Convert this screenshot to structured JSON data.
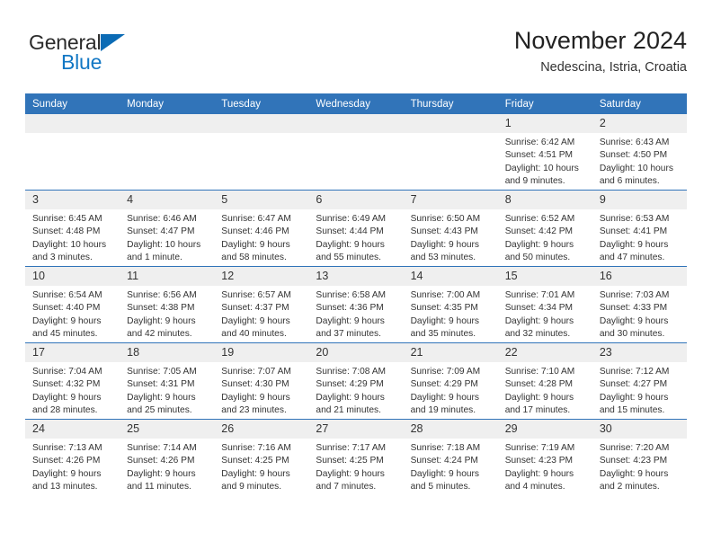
{
  "brand": {
    "name_part1": "General",
    "name_part2": "Blue",
    "triangle_color": "#0b6bb5",
    "text_color": "#2b2b2b",
    "blue_color": "#1277c4"
  },
  "header": {
    "title": "November 2024",
    "subtitle": "Nedescina, Istria, Croatia"
  },
  "theme": {
    "header_bar": "#3174b9",
    "daynum_bg": "#efefef",
    "cell_bg": "#ffffff",
    "text": "#333333"
  },
  "weekday_headers": [
    "Sunday",
    "Monday",
    "Tuesday",
    "Wednesday",
    "Thursday",
    "Friday",
    "Saturday"
  ],
  "weeks": [
    [
      {
        "day": "",
        "empty": true,
        "sunrise": "",
        "sunset": "",
        "daylight1": "",
        "daylight2": ""
      },
      {
        "day": "",
        "empty": true,
        "sunrise": "",
        "sunset": "",
        "daylight1": "",
        "daylight2": ""
      },
      {
        "day": "",
        "empty": true,
        "sunrise": "",
        "sunset": "",
        "daylight1": "",
        "daylight2": ""
      },
      {
        "day": "",
        "empty": true,
        "sunrise": "",
        "sunset": "",
        "daylight1": "",
        "daylight2": ""
      },
      {
        "day": "",
        "empty": true,
        "sunrise": "",
        "sunset": "",
        "daylight1": "",
        "daylight2": ""
      },
      {
        "day": "1",
        "empty": false,
        "sunrise": "Sunrise: 6:42 AM",
        "sunset": "Sunset: 4:51 PM",
        "daylight1": "Daylight: 10 hours",
        "daylight2": "and 9 minutes."
      },
      {
        "day": "2",
        "empty": false,
        "sunrise": "Sunrise: 6:43 AM",
        "sunset": "Sunset: 4:50 PM",
        "daylight1": "Daylight: 10 hours",
        "daylight2": "and 6 minutes."
      }
    ],
    [
      {
        "day": "3",
        "empty": false,
        "sunrise": "Sunrise: 6:45 AM",
        "sunset": "Sunset: 4:48 PM",
        "daylight1": "Daylight: 10 hours",
        "daylight2": "and 3 minutes."
      },
      {
        "day": "4",
        "empty": false,
        "sunrise": "Sunrise: 6:46 AM",
        "sunset": "Sunset: 4:47 PM",
        "daylight1": "Daylight: 10 hours",
        "daylight2": "and 1 minute."
      },
      {
        "day": "5",
        "empty": false,
        "sunrise": "Sunrise: 6:47 AM",
        "sunset": "Sunset: 4:46 PM",
        "daylight1": "Daylight: 9 hours",
        "daylight2": "and 58 minutes."
      },
      {
        "day": "6",
        "empty": false,
        "sunrise": "Sunrise: 6:49 AM",
        "sunset": "Sunset: 4:44 PM",
        "daylight1": "Daylight: 9 hours",
        "daylight2": "and 55 minutes."
      },
      {
        "day": "7",
        "empty": false,
        "sunrise": "Sunrise: 6:50 AM",
        "sunset": "Sunset: 4:43 PM",
        "daylight1": "Daylight: 9 hours",
        "daylight2": "and 53 minutes."
      },
      {
        "day": "8",
        "empty": false,
        "sunrise": "Sunrise: 6:52 AM",
        "sunset": "Sunset: 4:42 PM",
        "daylight1": "Daylight: 9 hours",
        "daylight2": "and 50 minutes."
      },
      {
        "day": "9",
        "empty": false,
        "sunrise": "Sunrise: 6:53 AM",
        "sunset": "Sunset: 4:41 PM",
        "daylight1": "Daylight: 9 hours",
        "daylight2": "and 47 minutes."
      }
    ],
    [
      {
        "day": "10",
        "empty": false,
        "sunrise": "Sunrise: 6:54 AM",
        "sunset": "Sunset: 4:40 PM",
        "daylight1": "Daylight: 9 hours",
        "daylight2": "and 45 minutes."
      },
      {
        "day": "11",
        "empty": false,
        "sunrise": "Sunrise: 6:56 AM",
        "sunset": "Sunset: 4:38 PM",
        "daylight1": "Daylight: 9 hours",
        "daylight2": "and 42 minutes."
      },
      {
        "day": "12",
        "empty": false,
        "sunrise": "Sunrise: 6:57 AM",
        "sunset": "Sunset: 4:37 PM",
        "daylight1": "Daylight: 9 hours",
        "daylight2": "and 40 minutes."
      },
      {
        "day": "13",
        "empty": false,
        "sunrise": "Sunrise: 6:58 AM",
        "sunset": "Sunset: 4:36 PM",
        "daylight1": "Daylight: 9 hours",
        "daylight2": "and 37 minutes."
      },
      {
        "day": "14",
        "empty": false,
        "sunrise": "Sunrise: 7:00 AM",
        "sunset": "Sunset: 4:35 PM",
        "daylight1": "Daylight: 9 hours",
        "daylight2": "and 35 minutes."
      },
      {
        "day": "15",
        "empty": false,
        "sunrise": "Sunrise: 7:01 AM",
        "sunset": "Sunset: 4:34 PM",
        "daylight1": "Daylight: 9 hours",
        "daylight2": "and 32 minutes."
      },
      {
        "day": "16",
        "empty": false,
        "sunrise": "Sunrise: 7:03 AM",
        "sunset": "Sunset: 4:33 PM",
        "daylight1": "Daylight: 9 hours",
        "daylight2": "and 30 minutes."
      }
    ],
    [
      {
        "day": "17",
        "empty": false,
        "sunrise": "Sunrise: 7:04 AM",
        "sunset": "Sunset: 4:32 PM",
        "daylight1": "Daylight: 9 hours",
        "daylight2": "and 28 minutes."
      },
      {
        "day": "18",
        "empty": false,
        "sunrise": "Sunrise: 7:05 AM",
        "sunset": "Sunset: 4:31 PM",
        "daylight1": "Daylight: 9 hours",
        "daylight2": "and 25 minutes."
      },
      {
        "day": "19",
        "empty": false,
        "sunrise": "Sunrise: 7:07 AM",
        "sunset": "Sunset: 4:30 PM",
        "daylight1": "Daylight: 9 hours",
        "daylight2": "and 23 minutes."
      },
      {
        "day": "20",
        "empty": false,
        "sunrise": "Sunrise: 7:08 AM",
        "sunset": "Sunset: 4:29 PM",
        "daylight1": "Daylight: 9 hours",
        "daylight2": "and 21 minutes."
      },
      {
        "day": "21",
        "empty": false,
        "sunrise": "Sunrise: 7:09 AM",
        "sunset": "Sunset: 4:29 PM",
        "daylight1": "Daylight: 9 hours",
        "daylight2": "and 19 minutes."
      },
      {
        "day": "22",
        "empty": false,
        "sunrise": "Sunrise: 7:10 AM",
        "sunset": "Sunset: 4:28 PM",
        "daylight1": "Daylight: 9 hours",
        "daylight2": "and 17 minutes."
      },
      {
        "day": "23",
        "empty": false,
        "sunrise": "Sunrise: 7:12 AM",
        "sunset": "Sunset: 4:27 PM",
        "daylight1": "Daylight: 9 hours",
        "daylight2": "and 15 minutes."
      }
    ],
    [
      {
        "day": "24",
        "empty": false,
        "sunrise": "Sunrise: 7:13 AM",
        "sunset": "Sunset: 4:26 PM",
        "daylight1": "Daylight: 9 hours",
        "daylight2": "and 13 minutes."
      },
      {
        "day": "25",
        "empty": false,
        "sunrise": "Sunrise: 7:14 AM",
        "sunset": "Sunset: 4:26 PM",
        "daylight1": "Daylight: 9 hours",
        "daylight2": "and 11 minutes."
      },
      {
        "day": "26",
        "empty": false,
        "sunrise": "Sunrise: 7:16 AM",
        "sunset": "Sunset: 4:25 PM",
        "daylight1": "Daylight: 9 hours",
        "daylight2": "and 9 minutes."
      },
      {
        "day": "27",
        "empty": false,
        "sunrise": "Sunrise: 7:17 AM",
        "sunset": "Sunset: 4:25 PM",
        "daylight1": "Daylight: 9 hours",
        "daylight2": "and 7 minutes."
      },
      {
        "day": "28",
        "empty": false,
        "sunrise": "Sunrise: 7:18 AM",
        "sunset": "Sunset: 4:24 PM",
        "daylight1": "Daylight: 9 hours",
        "daylight2": "and 5 minutes."
      },
      {
        "day": "29",
        "empty": false,
        "sunrise": "Sunrise: 7:19 AM",
        "sunset": "Sunset: 4:23 PM",
        "daylight1": "Daylight: 9 hours",
        "daylight2": "and 4 minutes."
      },
      {
        "day": "30",
        "empty": false,
        "sunrise": "Sunrise: 7:20 AM",
        "sunset": "Sunset: 4:23 PM",
        "daylight1": "Daylight: 9 hours",
        "daylight2": "and 2 minutes."
      }
    ]
  ]
}
